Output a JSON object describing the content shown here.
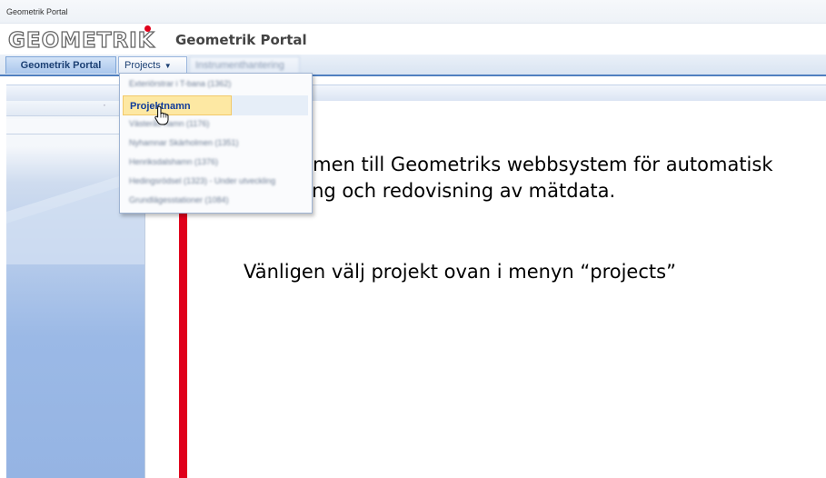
{
  "window": {
    "title": "Geometrik Portal"
  },
  "brand": {
    "logo_text": "GEOMETRIK",
    "app_title": "Geometrik Portal",
    "logo_dot_color": "#e0001b"
  },
  "menubar": {
    "tabs": [
      {
        "label": "Geometrik Portal"
      },
      {
        "label": "Projects"
      },
      {
        "label": "Instrumenthantering"
      }
    ]
  },
  "dropdown": {
    "items": [
      {
        "label": "Exteriörstrar i T-bana (1362)"
      },
      {
        "label": "Projektnamn"
      },
      {
        "label": "Västerås hamn (1176)"
      },
      {
        "label": "Nyhamnar Skärholmen (1351)"
      },
      {
        "label": "Henriksdalshamn (1376)"
      },
      {
        "label": "Hedingsrödsel (1323) - Under utveckling"
      },
      {
        "label": "Grundlägesstationer (1084)"
      }
    ]
  },
  "main": {
    "welcome": "Välkommen till Geometriks webbsystem för automatisk insamling och redovisning av mätdata.",
    "instruction": "Vänligen välj projekt ovan i menyn “projects”"
  },
  "colors": {
    "accent": "#e0001b",
    "menu_border": "#4f7fc0",
    "selected_item_bg": "#fde8a3",
    "selected_item_text": "#0f3b9b"
  },
  "icons": {
    "cursor": "hand-pointer-icon",
    "menu_caret": "caret-down-icon"
  }
}
